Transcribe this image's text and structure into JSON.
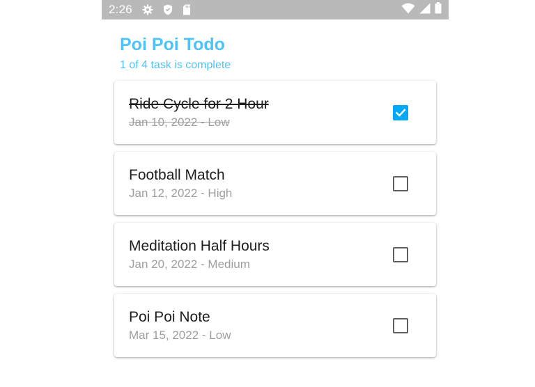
{
  "status_bar": {
    "time": "2:26",
    "left_icons": [
      "gear-icon",
      "shield-icon",
      "sd-card-icon"
    ],
    "right_icons": [
      "wifi-icon",
      "signal-icon",
      "battery-icon"
    ]
  },
  "header": {
    "title": "Poi Poi Todo",
    "subtitle": "1 of 4 task is complete"
  },
  "tasks": [
    {
      "title": "Ride Cycle for 2 Hour",
      "meta": "Jan 10, 2022 - Low",
      "completed": true
    },
    {
      "title": "Football Match",
      "meta": "Jan 12, 2022 - High",
      "completed": false
    },
    {
      "title": "Meditation Half Hours",
      "meta": "Jan 20, 2022 - Medium",
      "completed": false
    },
    {
      "title": "Poi Poi Note",
      "meta": "Mar 15, 2022 - Low",
      "completed": false
    }
  ],
  "colors": {
    "accent": "#4fc3f7",
    "checkbox_checked": "#03a9f4",
    "status_bar": "#b9b9b9"
  }
}
